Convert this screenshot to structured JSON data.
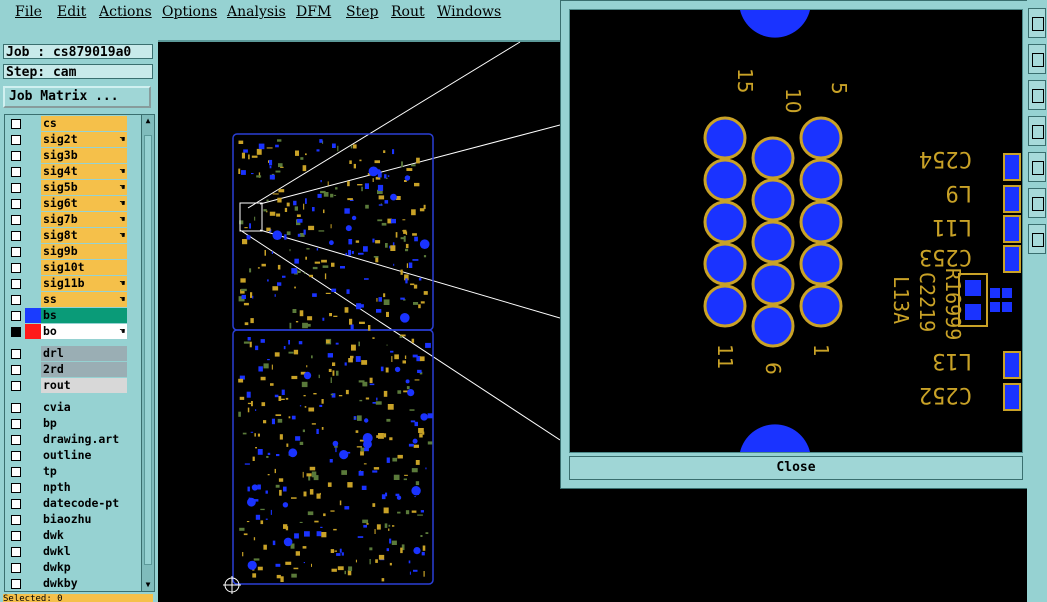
{
  "menu": {
    "items": [
      "File",
      "Edit",
      "Actions",
      "Options",
      "Analysis",
      "DFM",
      "Step",
      "Rout",
      "Windows"
    ]
  },
  "job": {
    "job_label": "Job : cs879019a0",
    "step_label": "Step: cam",
    "matrix_button": "Job Matrix ..."
  },
  "layers": [
    {
      "name": "cs",
      "color": "#f5c04a",
      "hand": false
    },
    {
      "name": "sig2t",
      "color": "#f5c04a",
      "hand": true
    },
    {
      "name": "sig3b",
      "color": "#f5c04a",
      "hand": false
    },
    {
      "name": "sig4t",
      "color": "#f5c04a",
      "hand": true
    },
    {
      "name": "sig5b",
      "color": "#f5c04a",
      "hand": true
    },
    {
      "name": "sig6t",
      "color": "#f5c04a",
      "hand": true
    },
    {
      "name": "sig7b",
      "color": "#f5c04a",
      "hand": true
    },
    {
      "name": "sig8t",
      "color": "#f5c04a",
      "hand": true
    },
    {
      "name": "sig9b",
      "color": "#f5c04a",
      "hand": false
    },
    {
      "name": "sig10t",
      "color": "#f5c04a",
      "hand": false
    },
    {
      "name": "sig11b",
      "color": "#f5c04a",
      "hand": true
    },
    {
      "name": "ss",
      "color": "#f5c04a",
      "hand": true
    },
    {
      "name": "bs",
      "color": "#0a9b78",
      "hand": false,
      "swatch": "#1a3cff"
    },
    {
      "name": "bo",
      "color": "#ffffff",
      "hand": true,
      "swatch": "#ff1a1a",
      "active": true
    },
    {
      "name": "drl",
      "color": "#9aaeb4",
      "hand": false
    },
    {
      "name": "2rd",
      "color": "#9aaeb4",
      "hand": false
    },
    {
      "name": "rout",
      "color": "#d8d8d8",
      "hand": false
    },
    {
      "name": "cvia",
      "color": "#96d2d2",
      "hand": false
    },
    {
      "name": "bp",
      "color": "#96d2d2",
      "hand": false
    },
    {
      "name": "drawing.art",
      "color": "#96d2d2",
      "hand": false
    },
    {
      "name": "outline",
      "color": "#96d2d2",
      "hand": false
    },
    {
      "name": "tp",
      "color": "#96d2d2",
      "hand": false
    },
    {
      "name": "npth",
      "color": "#96d2d2",
      "hand": false
    },
    {
      "name": "datecode-pt",
      "color": "#96d2d2",
      "hand": false
    },
    {
      "name": "biaozhu",
      "color": "#96d2d2",
      "hand": false
    },
    {
      "name": "dwk",
      "color": "#96d2d2",
      "hand": false
    },
    {
      "name": "dwkl",
      "color": "#96d2d2",
      "hand": false
    },
    {
      "name": "dwkp",
      "color": "#96d2d2",
      "hand": false
    },
    {
      "name": "dwkby",
      "color": "#96d2d2",
      "hand": false
    }
  ],
  "status_bottom": "Selected: 0",
  "zoom": {
    "pin_labels": [
      "15",
      "10",
      "5",
      "11",
      "6",
      "1"
    ],
    "refdes": [
      "C254",
      "L9",
      "L11",
      "C253",
      "L13",
      "C252",
      "R16999",
      "C2219",
      "L13A"
    ],
    "close_label": "Close"
  },
  "colors": {
    "panel": "#96d2d2",
    "copper": "#c9a227",
    "pad": "#1a33ff",
    "outline": "#2a3fd6"
  }
}
